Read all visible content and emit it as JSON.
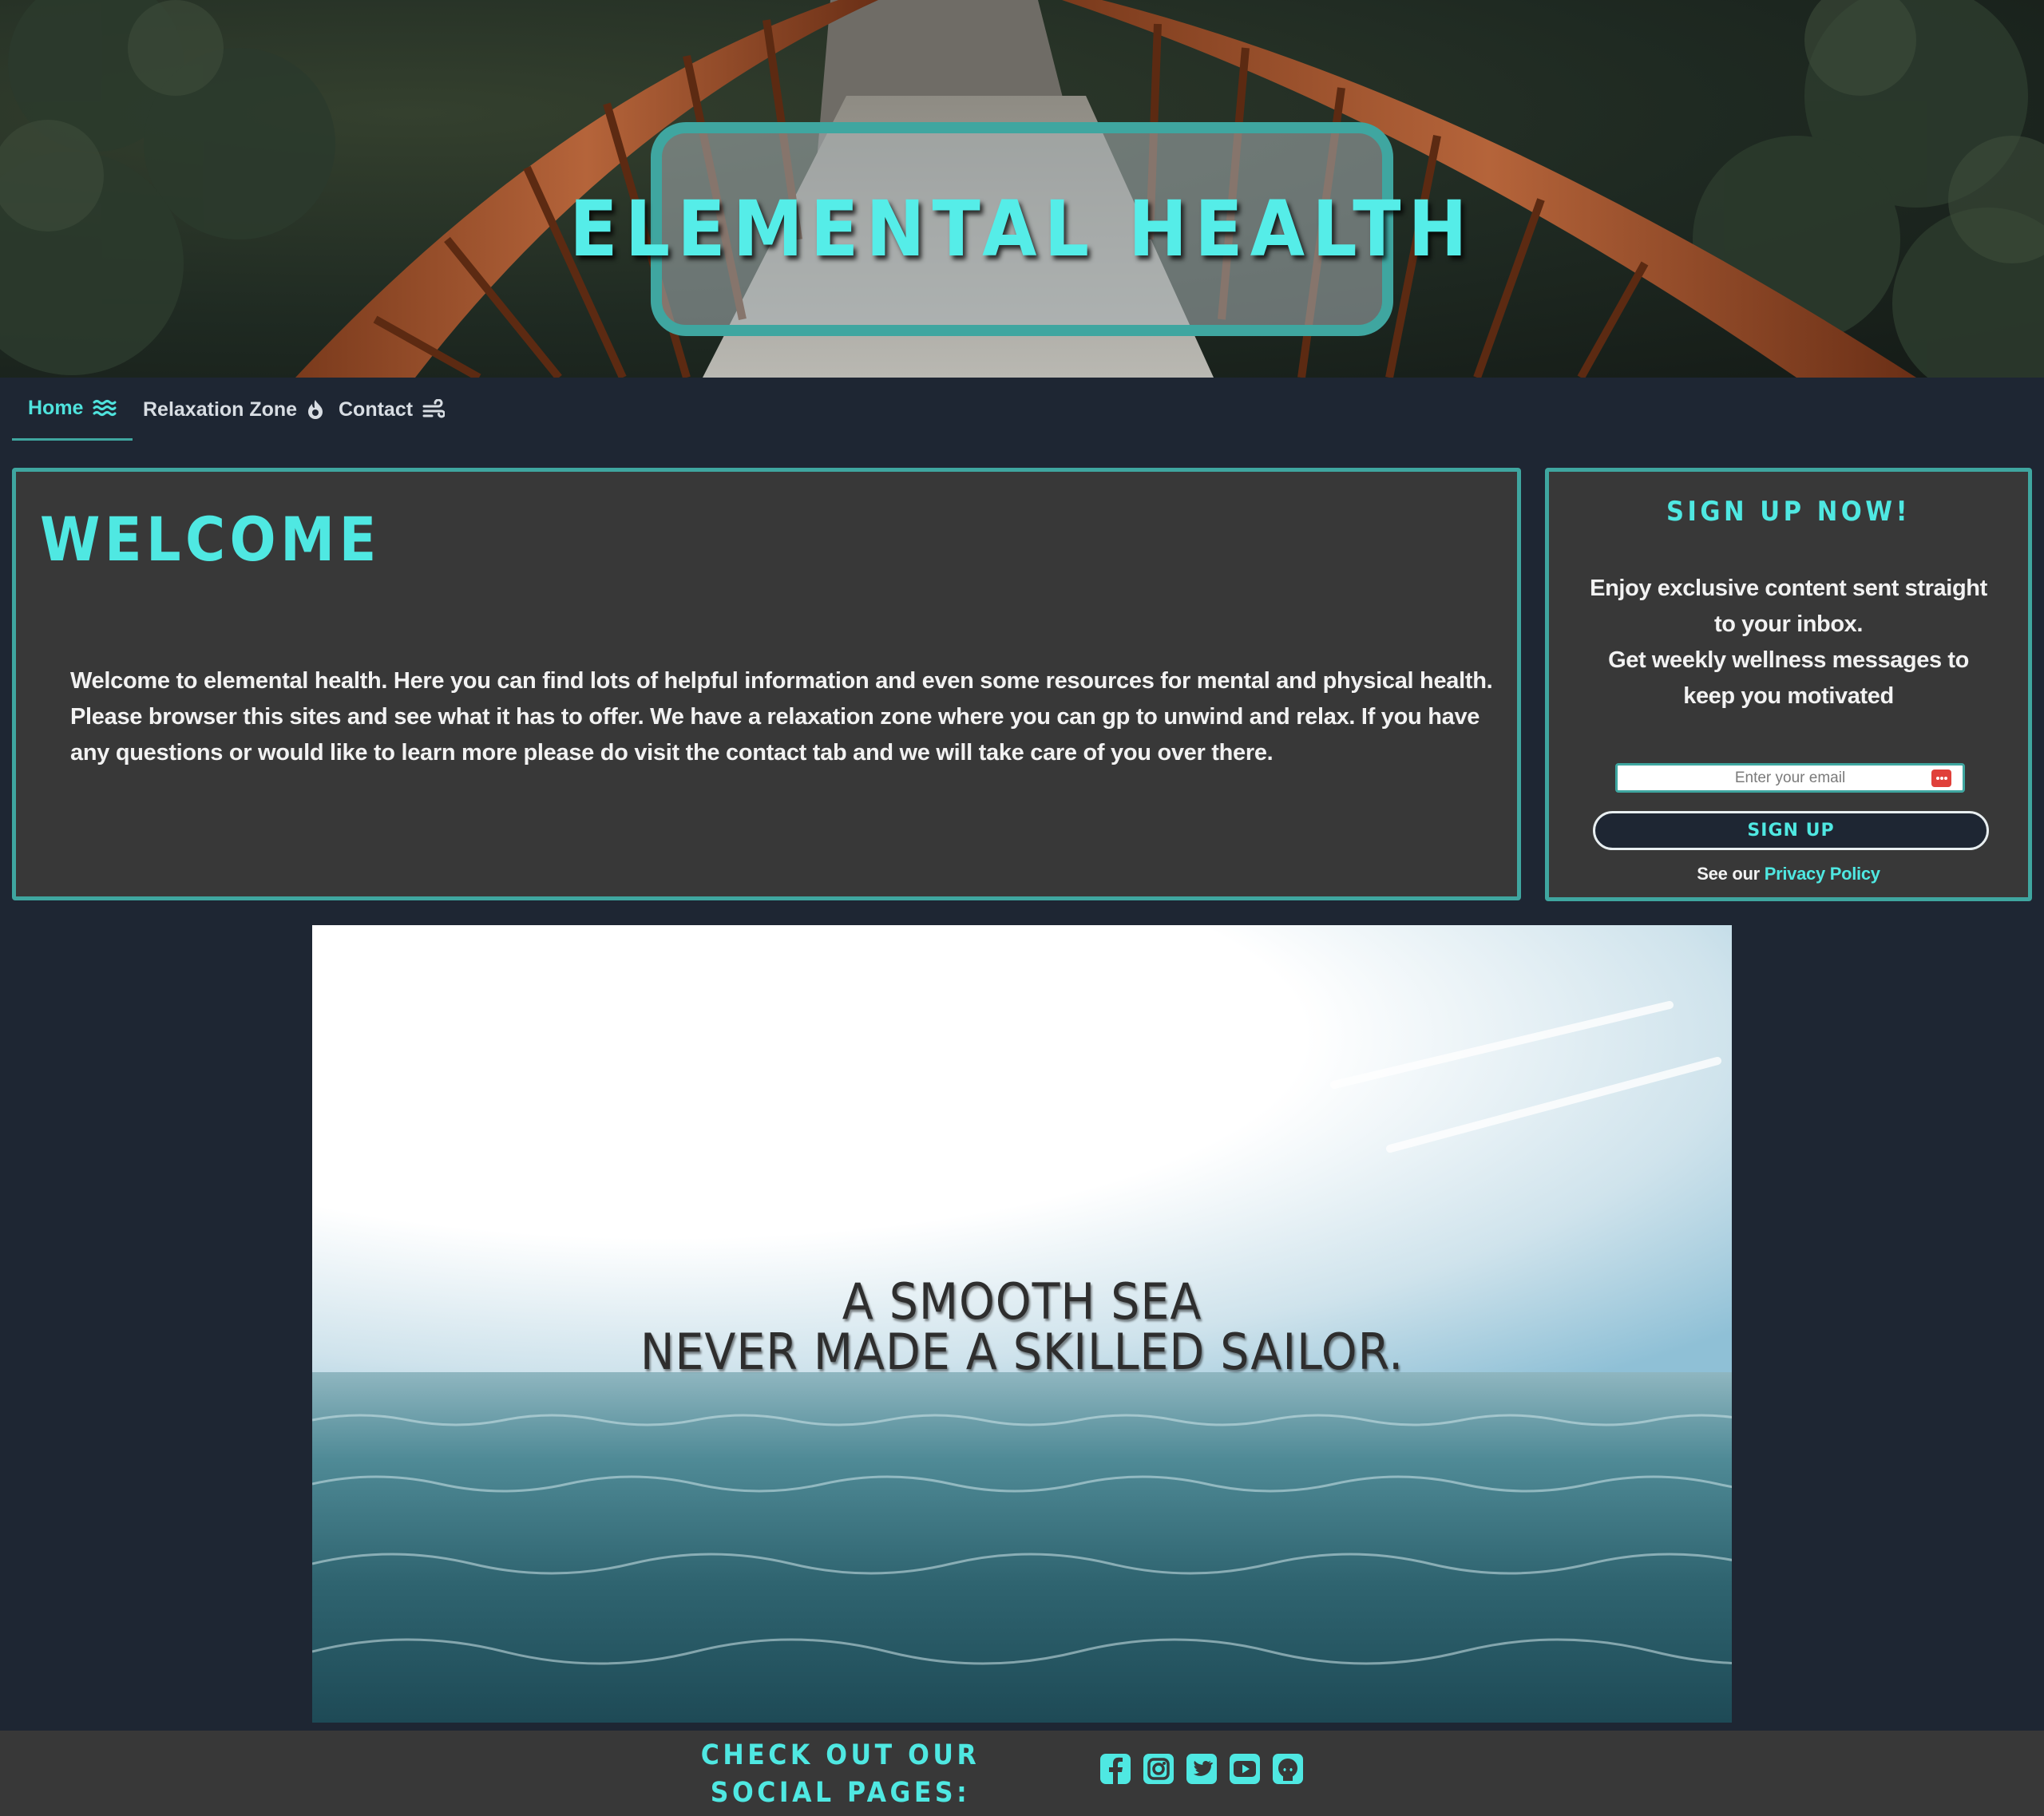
{
  "header": {
    "title": "ELEMENTAL HEALTH"
  },
  "nav": {
    "items": [
      {
        "label": "Home",
        "icon": "water-icon",
        "active": true
      },
      {
        "label": "Relaxation Zone",
        "icon": "fire-icon",
        "active": false
      },
      {
        "label": "Contact",
        "icon": "wind-icon",
        "active": false
      }
    ]
  },
  "welcome": {
    "title": "WELCOME",
    "text": "Welcome to elemental health. Here you can find lots of helpful information and even some resources for mental and physical health. Please browser this sites and see what it has to offer. We have a relaxation zone where you can gp to unwind and relax. If you have any questions or would like to learn more please do visit the contact tab and we will take care of you over there."
  },
  "signup": {
    "title": "SIGN UP NOW!",
    "text_line1": "Enjoy exclusive content sent straight to your inbox.",
    "text_line2": "Get weekly wellness messages to keep you motivated",
    "email_placeholder": "Enter your email",
    "button_label": "SIGN UP",
    "privacy_prefix": "See our",
    "privacy_link": "Privacy Policy"
  },
  "quote": {
    "line1": "A SMOOTH SEA",
    "line2": "NEVER MADE A SKILLED SAILOR."
  },
  "footer": {
    "heading_line1": "CHECK OUT OUR",
    "heading_line2": "SOCIAL PAGES:",
    "socials": [
      "facebook-icon",
      "instagram-icon",
      "twitter-icon",
      "youtube-icon",
      "github-icon"
    ]
  },
  "colors": {
    "accent": "#4fe8e2",
    "border": "#3fa6a0",
    "page_bg": "#1e2633",
    "card_bg": "#383838"
  }
}
